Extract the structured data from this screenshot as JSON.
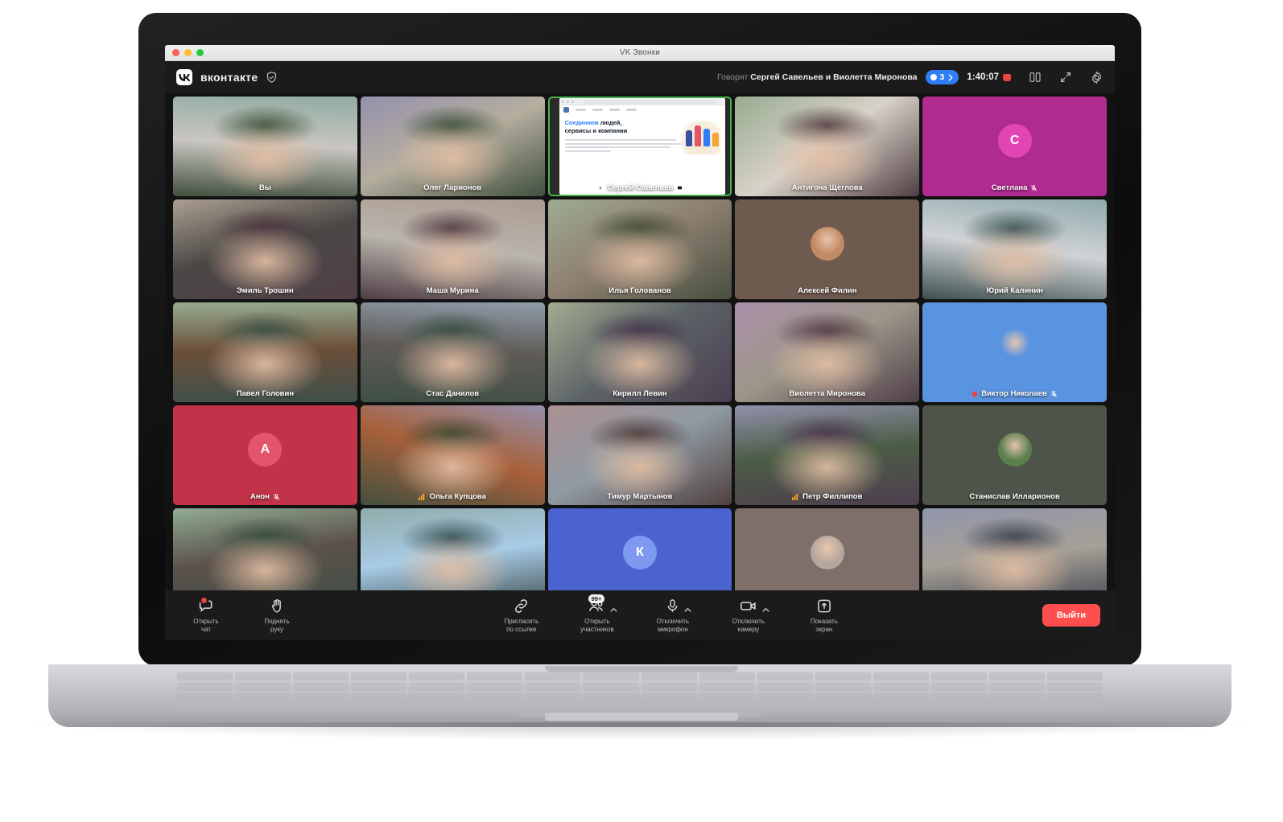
{
  "window": {
    "title": "VK Звонки",
    "traffic_lights": [
      "close",
      "minimize",
      "zoom"
    ]
  },
  "header": {
    "brand": "вконтакте",
    "shield_icon": "shield-check-icon",
    "speaking_prefix": "Говорят",
    "speaking_names": "Сергей Савельев и Виолетта Миронова",
    "participants_badge": "3",
    "timer": "1:40:07",
    "recording_icon": "recording-indicator-icon",
    "layout_icon": "layout-grid-icon",
    "fullscreen_icon": "expand-icon",
    "settings_icon": "gear-icon",
    "accent_blue": "#2f7ef7",
    "record_red": "#e8453c"
  },
  "grid": {
    "rows": [
      [
        {
          "name": "Вы",
          "kind": "video",
          "bg": "#c9c6c1",
          "skin": "person-dark-hoodie",
          "muted": false
        },
        {
          "name": "Олег Ларионов",
          "kind": "video",
          "bg": "#b5ae9f",
          "skin": "person-blue-chair",
          "muted": false
        },
        {
          "name": "Сергей Савельев",
          "kind": "screenshare",
          "share_icon": "screen-share-icon",
          "speaking": true,
          "share": {
            "headline_accent": "Соединяем",
            "headline_rest": "людей,",
            "headline_line2": "сервисы и компании"
          }
        },
        {
          "name": "Антигона Щеглова",
          "kind": "video",
          "bg": "#d8d2c8",
          "skin": "person-long-hair",
          "muted": false
        },
        {
          "name": "Светлана",
          "kind": "avatar-letter",
          "letter": "С",
          "bg": "#b02b8f",
          "avatar_bg": "#e246b4",
          "muted": true
        }
      ],
      [
        {
          "name": "Эмиль Трошин",
          "kind": "video",
          "bg": "#4a4745",
          "skin": "person-grey-wall",
          "muted": false
        },
        {
          "name": "Маша Мурина",
          "kind": "video",
          "bg": "#b9b4ac",
          "skin": "person-outdoor",
          "muted": false
        },
        {
          "name": "Илья Голованов",
          "kind": "video",
          "bg": "#8e7f72",
          "skin": "person-with-fox",
          "muted": false
        },
        {
          "name": "Алексей Филин",
          "kind": "avatar-photo",
          "bg": "#6e5a4f",
          "avatar_bg": "#c08a63",
          "muted": false
        },
        {
          "name": "Юрий Калинин",
          "kind": "video",
          "bg": "#cfd3d6",
          "skin": "person-office",
          "muted": false
        }
      ],
      [
        {
          "name": "Павел Головин",
          "kind": "video",
          "bg": "#6b4f39",
          "skin": "person-wood-room",
          "muted": false
        },
        {
          "name": "Стас Данилов",
          "kind": "video",
          "bg": "#5e5a55",
          "skin": "person-sunglasses",
          "muted": false
        },
        {
          "name": "Кирилл Левин",
          "kind": "video",
          "bg": "#5d6468",
          "skin": "person-waving",
          "muted": false
        },
        {
          "name": "Виолетта Миронова",
          "kind": "video",
          "bg": "#9c9689",
          "skin": "person-street",
          "speaking": true,
          "muted": false
        },
        {
          "name": "Виктор Николаев",
          "kind": "avatar-photo",
          "bg": "#5a93e0",
          "avatar_bg": "#5a93e0",
          "muted": true,
          "poor_connection": true
        }
      ],
      [
        {
          "name": "Анон",
          "kind": "avatar-letter",
          "letter": "А",
          "bg": "#c23248",
          "avatar_bg": "#e2556a",
          "muted": true
        },
        {
          "name": "Ольга Купцова",
          "kind": "video",
          "bg": "#a8603a",
          "skin": "person-blonde",
          "signal": true
        },
        {
          "name": "Тимур Мартынов",
          "kind": "video",
          "bg": "#8f9aa3",
          "skin": "person-window",
          "muted": false
        },
        {
          "name": "Петр Филлипов",
          "kind": "video",
          "bg": "#4b5c45",
          "skin": "group-selfie",
          "signal": true
        },
        {
          "name": "Станислав Илларионов",
          "kind": "avatar-photo",
          "bg": "#4e5449",
          "avatar_bg": "#5c7f4e",
          "muted": false
        }
      ],
      [
        {
          "name": "",
          "kind": "video",
          "bg": "#5b514b",
          "skin": "person-partial-1"
        },
        {
          "name": "",
          "kind": "video",
          "bg": "#a8cbe6",
          "skin": "person-partial-2"
        },
        {
          "name": "",
          "kind": "avatar-letter",
          "letter": "К",
          "bg": "#4a63cf",
          "avatar_bg": "#7f99f0"
        },
        {
          "name": "",
          "kind": "avatar-photo",
          "bg": "#7e6f6a",
          "avatar_bg": "#b6a79c"
        },
        {
          "name": "",
          "kind": "video",
          "bg": "#a6a096",
          "skin": "person-partial-3"
        }
      ]
    ]
  },
  "toolbar": {
    "chat": {
      "label": "Открыть\nчат",
      "icon": "chat-bubble-icon",
      "has_unread": true
    },
    "raise_hand": {
      "label": "Поднять\nруку",
      "icon": "raised-hand-icon"
    },
    "invite": {
      "label": "Пригласить\nпо ссылке",
      "icon": "link-icon"
    },
    "participants": {
      "label": "Открыть\nучастников",
      "icon": "people-icon",
      "count_badge": "99+",
      "has_caret": true
    },
    "microphone": {
      "label": "Отключить\nмикрофон",
      "icon": "microphone-icon",
      "has_caret": true
    },
    "camera": {
      "label": "Отключить\nкамеру",
      "icon": "camera-icon",
      "has_caret": true
    },
    "share_screen": {
      "label": "Показать\nэкран",
      "icon": "share-screen-icon"
    },
    "leave": {
      "label": "Выйти",
      "color": "#ff4e4e"
    }
  }
}
